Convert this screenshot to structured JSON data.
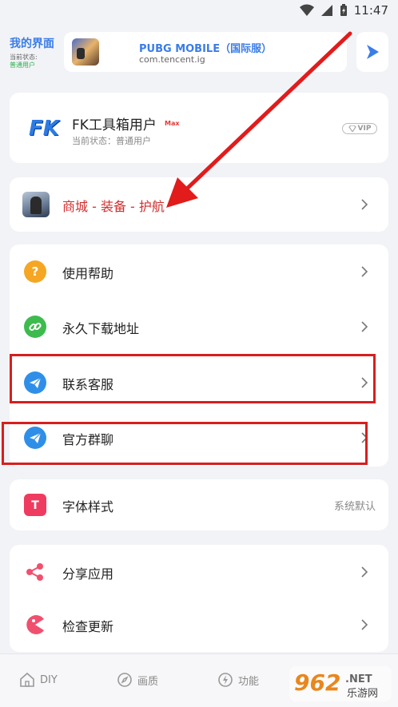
{
  "status_bar": {
    "time": "11:47"
  },
  "header": {
    "title": "我的界面",
    "status_label": "当前状态:",
    "status_value": "普通用户"
  },
  "game": {
    "name": "PUBG MOBILE（国际服）",
    "package": "com.tencent.ig"
  },
  "user": {
    "logo": "FK",
    "name": "FK工具箱用户",
    "badge": "Max",
    "status": "当前状态：普通用户",
    "vip": "VIP"
  },
  "shop": {
    "label": "商城 - 装备 - 护航"
  },
  "menu": {
    "items": [
      {
        "label": "使用帮助",
        "icon": "question-icon",
        "color": "#f5a623"
      },
      {
        "label": "永久下载地址",
        "icon": "link-icon",
        "color": "#3dbb4f"
      },
      {
        "label": "联系客服",
        "icon": "telegram-icon",
        "color": "#2f8fe8"
      },
      {
        "label": "官方群聊",
        "icon": "telegram-icon",
        "color": "#2f8fe8"
      }
    ]
  },
  "font_setting": {
    "label": "字体样式",
    "value": "系统默认",
    "icon": "font-icon",
    "color": "#ef3b5f"
  },
  "more": {
    "items": [
      {
        "label": "分享应用",
        "icon": "share-icon",
        "color": "#f0506e"
      },
      {
        "label": "检查更新",
        "icon": "update-icon",
        "color": "#f0506e"
      }
    ]
  },
  "tabs": [
    {
      "label": "DIY",
      "icon": "home-icon"
    },
    {
      "label": "画质",
      "icon": "compass-icon"
    },
    {
      "label": "功能",
      "icon": "bolt-icon"
    }
  ],
  "watermark": {
    "brand": "962",
    "suffix": ".NET",
    "site": "乐游网"
  },
  "colors": {
    "accent": "#3a7ce8",
    "highlight": "#d81e1e",
    "arrow": "#e21b1b"
  }
}
